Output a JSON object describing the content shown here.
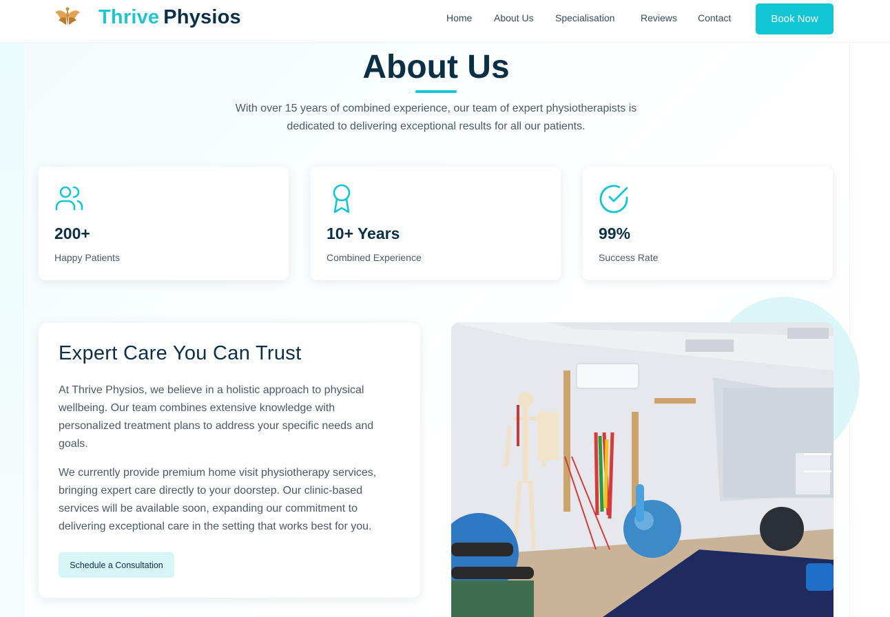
{
  "brand": {
    "part1": "Thrive",
    "part2": "Physios",
    "logo": "wings-logo"
  },
  "nav": {
    "items": [
      "Home",
      "About Us",
      "Specialisation",
      "Reviews",
      "Contact"
    ],
    "cta": "Book Now"
  },
  "hero": {
    "title": "About Us",
    "intro": "With over 15 years of combined experience, our team of expert physiotherapists is dedicated to delivering exceptional results for all our patients."
  },
  "stats": [
    {
      "icon": "users-icon",
      "value": "200+",
      "label": "Happy Patients"
    },
    {
      "icon": "award-icon",
      "value": "10+ Years",
      "label": "Combined Experience"
    },
    {
      "icon": "check-circle-icon",
      "value": "99%",
      "label": "Success Rate"
    }
  ],
  "expert": {
    "heading": "Expert Care You Can Trust",
    "para1": "At Thrive Physios, we believe in a holistic approach to physical wellbeing. Our team combines extensive knowledge with personalized treatment plans to address your specific needs and goals.",
    "para2": "We currently provide premium home visit physiotherapy services, bringing expert care directly to your doorstep. Our clinic-based services will be available soon, expanding our commitment to delivering exceptional care in the setting that works best for you.",
    "button": "Schedule a Consultation"
  },
  "colors": {
    "accent": "#11c6d2",
    "navy": "#0b2f45",
    "text": "#4b5968"
  }
}
